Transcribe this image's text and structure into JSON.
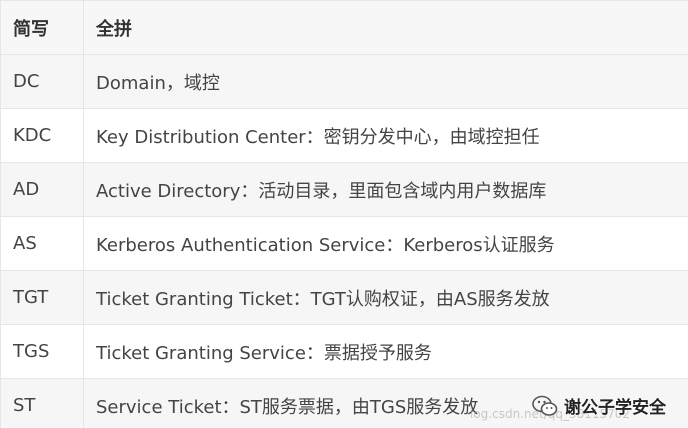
{
  "table": {
    "headers": [
      "简写",
      "全拼"
    ],
    "rows": [
      {
        "abbr": "DC",
        "full": "Domain，域控"
      },
      {
        "abbr": "KDC",
        "full": "Key Distribution Center：密钥分发中心，由域控担任"
      },
      {
        "abbr": "AD",
        "full": "Active Directory：活动目录，里面包含域内用户数据库"
      },
      {
        "abbr": "AS",
        "full": "Kerberos Authentication Service：Kerberos认证服务"
      },
      {
        "abbr": "TGT",
        "full": "Ticket Granting Ticket：TGT认购权证，由AS服务发放"
      },
      {
        "abbr": "TGS",
        "full": "Ticket Granting Service：票据授予服务"
      },
      {
        "abbr": "ST",
        "full": "Service Ticket：ST服务票据，由TGS服务发放"
      }
    ]
  },
  "watermark": {
    "text": "log.csdn.net/qq_38115702"
  },
  "wechat": {
    "icon": "wechat-icon",
    "label": "谢公子学安全"
  }
}
